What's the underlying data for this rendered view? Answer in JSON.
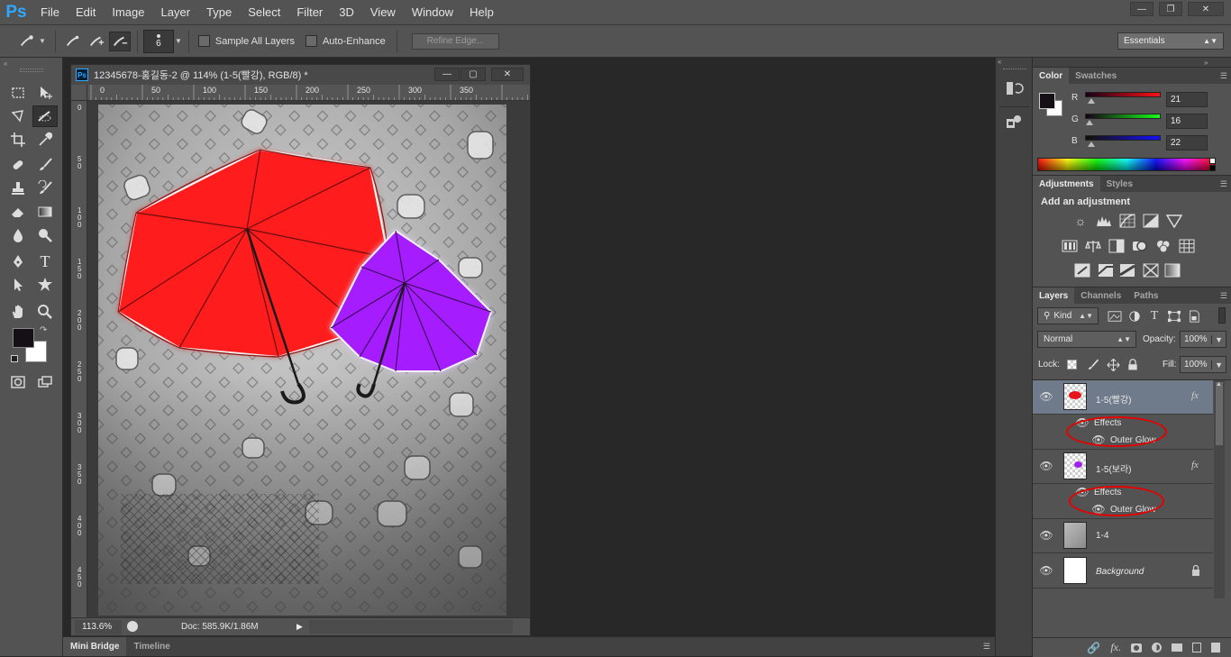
{
  "app": {
    "logo": "Ps"
  },
  "menubar": {
    "items": [
      "File",
      "Edit",
      "Image",
      "Layer",
      "Type",
      "Select",
      "Filter",
      "3D",
      "View",
      "Window",
      "Help"
    ]
  },
  "options": {
    "brush_size": "6",
    "sample_all_layers": "Sample All Layers",
    "auto_enhance": "Auto-Enhance",
    "refine_edge": "Refine Edge...",
    "workspace": "Essentials"
  },
  "document": {
    "title": "12345678-홍길동-2 @ 114% (1-5(빨강), RGB/8) *",
    "zoom": "113.6%",
    "doc_info": "Doc: 585.9K/1.86M",
    "ruler_h": [
      "0",
      "50",
      "100",
      "150",
      "200",
      "250",
      "300",
      "350"
    ],
    "ruler_v": [
      "0",
      "5\n0",
      "1\n0\n0",
      "1\n5\n0",
      "2\n0\n0",
      "2\n5\n0",
      "3\n0\n0",
      "3\n5\n0",
      "4\n0\n0",
      "4\n5\n0"
    ]
  },
  "bottom_panel": {
    "tabs": [
      "Mini Bridge",
      "Timeline"
    ]
  },
  "color_panel": {
    "tabs": [
      "Color",
      "Swatches"
    ],
    "r_label": "R",
    "g_label": "G",
    "b_label": "B",
    "r": "21",
    "g": "16",
    "b": "22",
    "r_fraction": 0.082,
    "g_fraction": 0.063,
    "b_fraction": 0.086
  },
  "adjustments_panel": {
    "tabs": [
      "Adjustments",
      "Styles"
    ],
    "heading": "Add an adjustment",
    "icons_row1": [
      "brightness-icon",
      "levels-icon",
      "curves-icon",
      "exposure-icon",
      "vibrance-icon"
    ],
    "icons_row2": [
      "hue-saturation-icon",
      "color-balance-icon",
      "black-white-icon",
      "photo-filter-icon",
      "channel-mixer-icon",
      "color-lookup-icon"
    ],
    "icons_row3": [
      "invert-icon",
      "posterize-icon",
      "threshold-icon",
      "selective-color-icon",
      "gradient-map-icon"
    ]
  },
  "layers_panel": {
    "tabs": [
      "Layers",
      "Channels",
      "Paths"
    ],
    "kind": "Kind",
    "blend_mode": "Normal",
    "opacity_label": "Opacity:",
    "opacity": "100%",
    "lock_label": "Lock:",
    "fill_label": "Fill:",
    "fill": "100%",
    "layers": [
      {
        "name": "1-5(빨강)",
        "fx": "fx",
        "effects": "Effects",
        "effect": "Outer Glow",
        "thumb_color": "#e8141c",
        "selected": true
      },
      {
        "name": "1-5(보라)",
        "fx": "fx",
        "effects": "Effects",
        "effect": "Outer Glow",
        "thumb_color": "#a020f0",
        "selected": false
      },
      {
        "name": "1-4"
      },
      {
        "name": "Background"
      }
    ]
  },
  "colors": {
    "umbrella_red": "#ff1a1a",
    "umbrella_purple": "#a51eff",
    "annotation_red": "#e60000",
    "foreground": "#151016",
    "background": "#ffffff"
  }
}
